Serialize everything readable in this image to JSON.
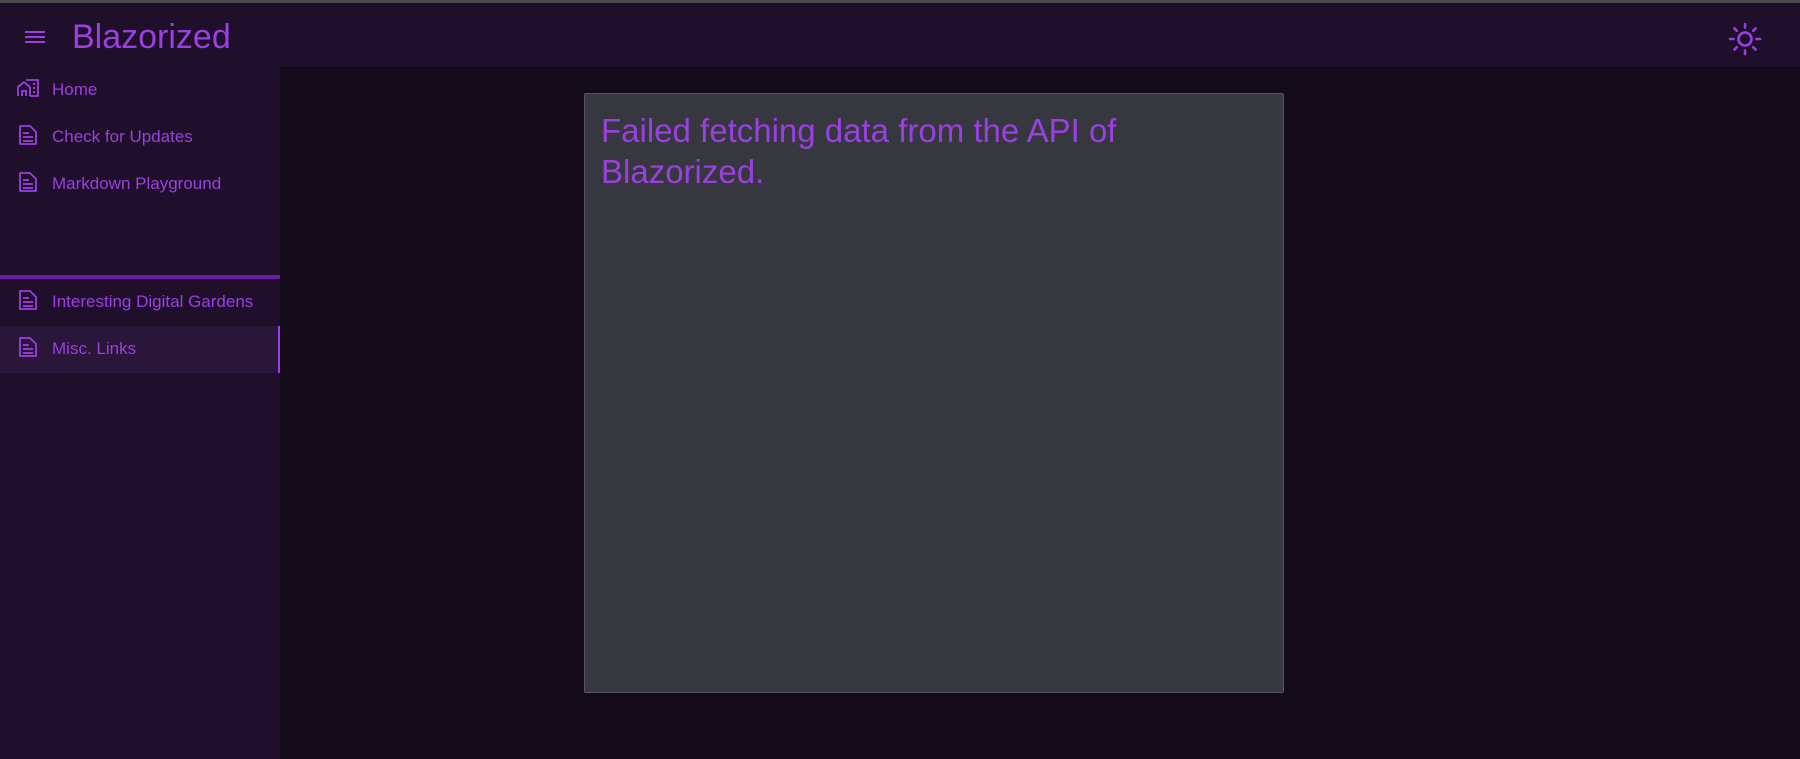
{
  "app": {
    "title": "Blazorized",
    "menu_icon": "hamburger-menu-icon",
    "theme_icon": "sun-icon"
  },
  "sidebar": {
    "items": [
      {
        "label": "Home",
        "icon": "home-city-icon",
        "active": false
      },
      {
        "label": "Check for Updates",
        "icon": "document-icon",
        "active": false
      },
      {
        "label": "Markdown Playground",
        "icon": "document-icon",
        "active": false
      },
      {
        "label": "Interesting Digital Gardens",
        "icon": "document-icon",
        "active": false
      },
      {
        "label": "Misc. Links",
        "icon": "document-icon",
        "active": true
      }
    ]
  },
  "main": {
    "message": "Failed fetching data from the API of Blazorized."
  },
  "colors": {
    "accent": "#9a3fe0",
    "appbar_bg": "#1f0f2b",
    "page_bg": "#140b1a",
    "card_bg": "#37373f",
    "divider": "#6a1fa8"
  }
}
